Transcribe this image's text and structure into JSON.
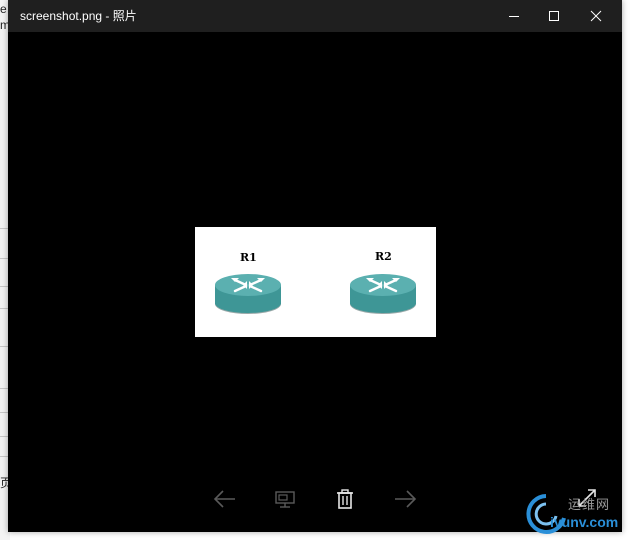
{
  "window": {
    "title": "screenshot.png - 照片"
  },
  "photo": {
    "routers": [
      {
        "label": "R1"
      },
      {
        "label": "R2"
      }
    ]
  },
  "controls": {
    "icons": [
      "arrow-left-icon",
      "slideshow-icon",
      "delete-icon",
      "arrow-right-icon",
      "fullscreen-icon"
    ]
  },
  "watermark": {
    "text_top": "运维网",
    "text_bottom": "iyunv.com"
  },
  "background_window": {
    "glyphs": [
      "e",
      "m",
      "页"
    ]
  },
  "colors": {
    "titlebar": "#1f1f1f",
    "canvas": "#000000",
    "router_body": "#3e9696",
    "router_top": "#5bb0b0",
    "watermark_blue": "#2a8fd8"
  }
}
